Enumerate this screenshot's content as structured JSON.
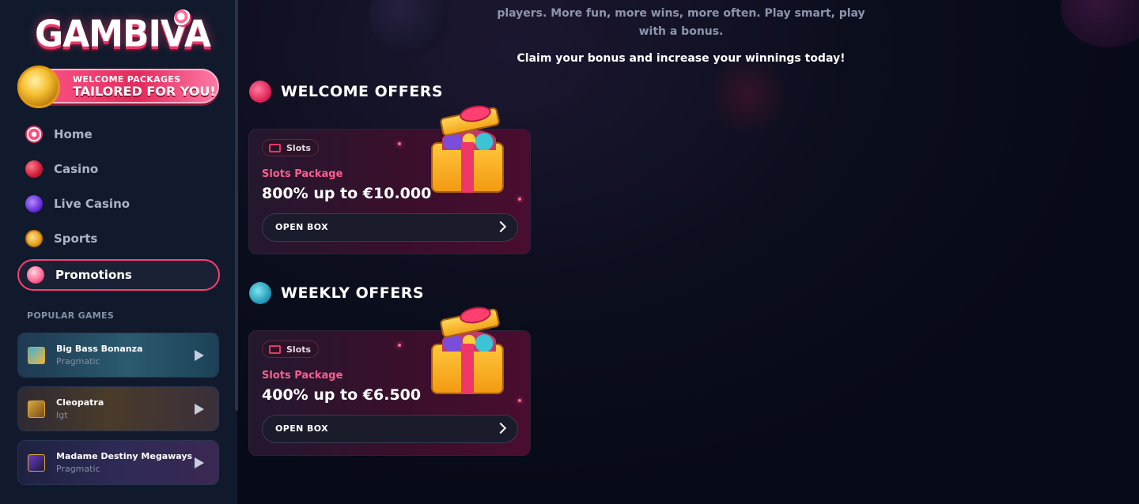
{
  "brand": {
    "logo_text": "GAMBIVA"
  },
  "welcome_banner": {
    "line1": "WELCOME PACKAGES",
    "line2": "TAILORED FOR YOU!"
  },
  "sidebar": {
    "nav": [
      {
        "label": "Home",
        "icon": "swirl-candy-icon"
      },
      {
        "label": "Casino",
        "icon": "cherry-icon"
      },
      {
        "label": "Live Casino",
        "icon": "purple-chip-icon"
      },
      {
        "label": "Sports",
        "icon": "medal-icon"
      },
      {
        "label": "Promotions",
        "icon": "cupcake-icon",
        "active": true
      }
    ],
    "popular_title": "POPULAR GAMES",
    "games": [
      {
        "name": "Big Bass Bonanza",
        "provider": "Pragmatic"
      },
      {
        "name": "Cleopatra",
        "provider": "Igt"
      },
      {
        "name": "Madame Destiny Megaways",
        "provider": "Pragmatic"
      }
    ]
  },
  "main": {
    "intro": "players. More fun, more wins, more often. Play smart, play with a bonus.",
    "claim": "Claim your bonus and increase your winnings today!",
    "sections": [
      {
        "title": "WELCOME OFFERS",
        "offer": {
          "tag": "Slots",
          "type": "Slots Package",
          "amount": "800% up to €10.000",
          "button": "OPEN BOX"
        }
      },
      {
        "title": "WEEKLY OFFERS",
        "offer": {
          "tag": "Slots",
          "type": "Slots Package",
          "amount": "400% up to €6.500",
          "button": "OPEN BOX"
        }
      }
    ]
  },
  "colors": {
    "accent": "#ff3d74",
    "sidebar_bg": "#111a2c",
    "page_bg": "#070a18",
    "offer_type": "#ff5f8f"
  }
}
